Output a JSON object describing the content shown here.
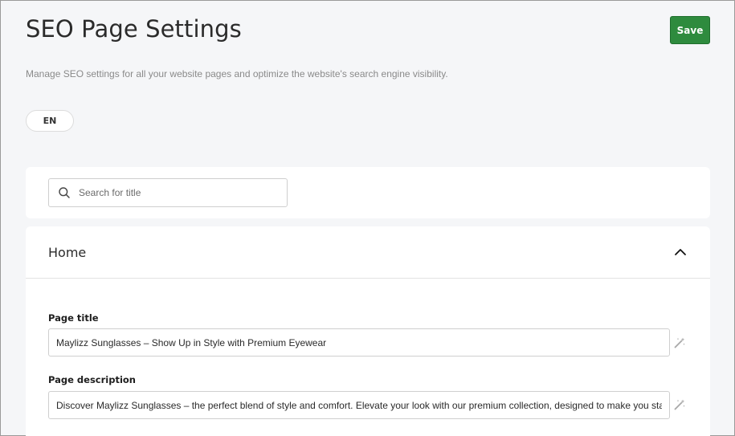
{
  "header": {
    "title": "SEO Page Settings",
    "save_label": "Save",
    "subtitle": "Manage SEO settings for all your website pages and optimize the website's search engine visibility."
  },
  "language": {
    "selected": "EN"
  },
  "search": {
    "placeholder": "Search for title",
    "value": "",
    "icon": "search-icon"
  },
  "sections": [
    {
      "title": "Home",
      "expanded": true,
      "fields": {
        "page_title": {
          "label": "Page title",
          "value": "Maylizz Sunglasses – Show Up in Style with Premium Eyewear"
        },
        "page_description": {
          "label": "Page description",
          "value": "Discover Maylizz Sunglasses – the perfect blend of style and comfort. Elevate your look with our premium collection, designed to make you stand out."
        }
      }
    }
  ],
  "colors": {
    "background": "#f5f6f8",
    "save_button": "#2e8b3e",
    "card": "#ffffff"
  }
}
